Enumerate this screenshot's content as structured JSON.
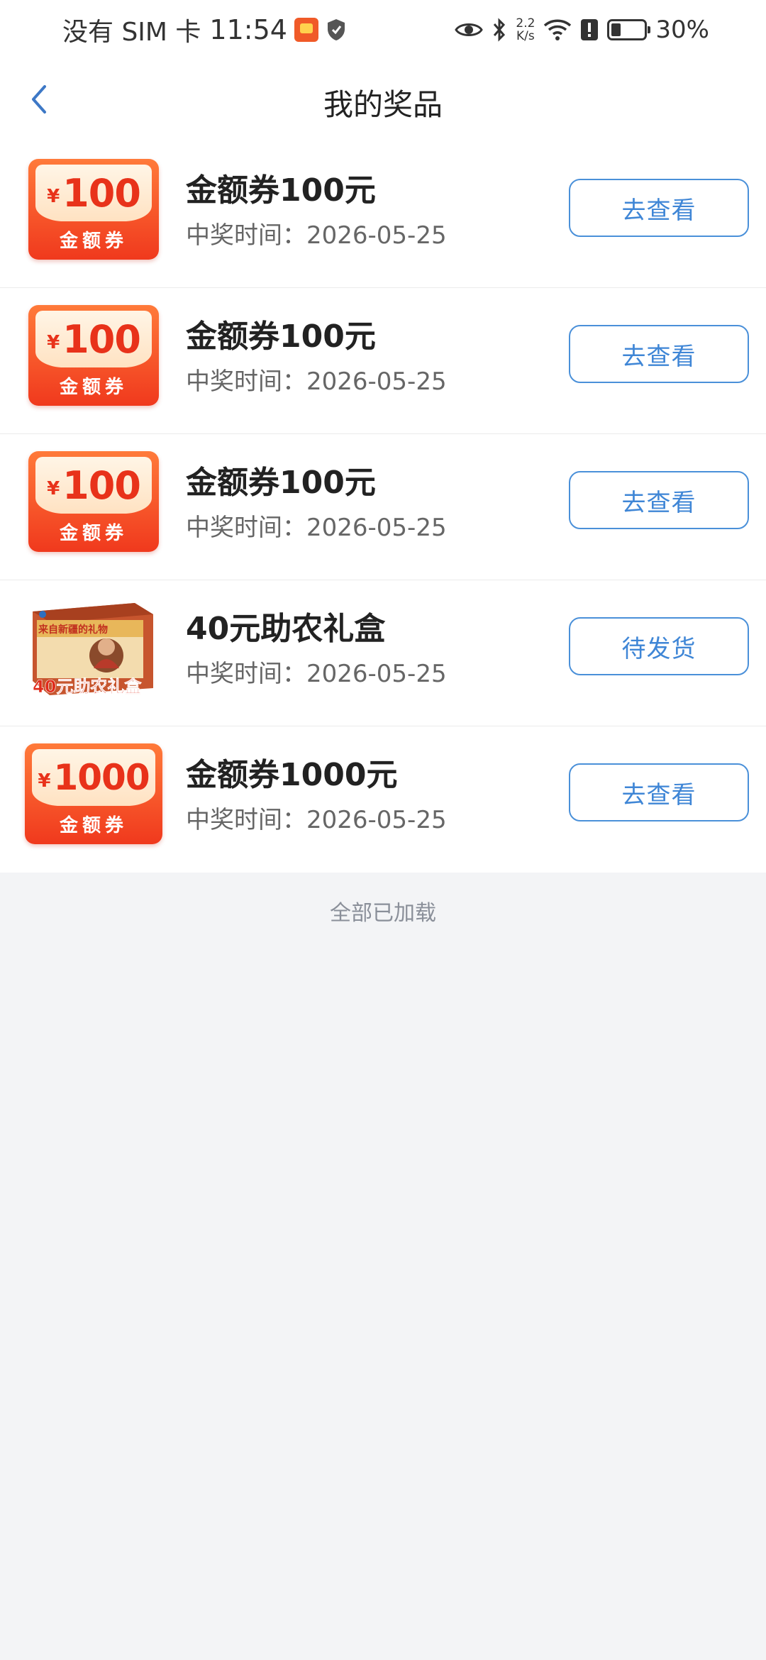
{
  "status_bar": {
    "sim": "没有 SIM 卡",
    "time": "11:54",
    "net_speed_value": "2.2",
    "net_speed_unit": "K/s",
    "battery": "30%"
  },
  "nav": {
    "title": "我的奖品"
  },
  "prizes": [
    {
      "title": "金额券100元",
      "time_label": "中奖时间：",
      "date": "2026-05-25",
      "action": "去查看",
      "thumb_type": "coupon",
      "coupon_symbol": "¥",
      "coupon_amount": "100",
      "coupon_label": "金额券"
    },
    {
      "title": "金额券100元",
      "time_label": "中奖时间：",
      "date": "2026-05-25",
      "action": "去查看",
      "thumb_type": "coupon",
      "coupon_symbol": "¥",
      "coupon_amount": "100",
      "coupon_label": "金额券"
    },
    {
      "title": "金额券100元",
      "time_label": "中奖时间：",
      "date": "2026-05-25",
      "action": "去查看",
      "thumb_type": "coupon",
      "coupon_symbol": "¥",
      "coupon_amount": "100",
      "coupon_label": "金额券"
    },
    {
      "title": "40元助农礼盒",
      "time_label": "中奖时间：",
      "date": "2026-05-25",
      "action": "待发货",
      "thumb_type": "giftbox",
      "box_caption": "40元助农礼盒",
      "box_header": "来自新疆的礼物"
    },
    {
      "title": "金额券1000元",
      "time_label": "中奖时间：",
      "date": "2026-05-25",
      "action": "去查看",
      "thumb_type": "coupon",
      "coupon_symbol": "¥",
      "coupon_amount": "1000",
      "coupon_label": "金额券"
    }
  ],
  "footer": {
    "text": "全部已加载"
  },
  "colors": {
    "accent_blue": "#4a90d9",
    "coupon_red": "#f0391d",
    "page_bg": "#f3f4f6"
  }
}
